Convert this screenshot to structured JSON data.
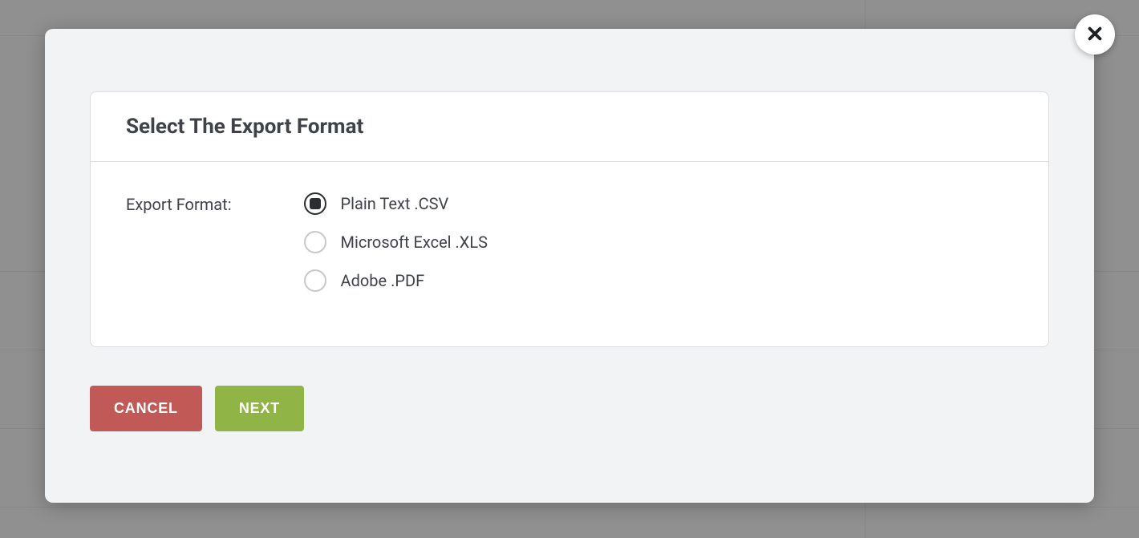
{
  "dialog": {
    "title": "Select The Export Format",
    "fieldLabel": "Export Format:",
    "options": [
      {
        "label": "Plain Text .CSV",
        "selected": true
      },
      {
        "label": "Microsoft Excel .XLS",
        "selected": false
      },
      {
        "label": "Adobe .PDF",
        "selected": false
      }
    ],
    "buttons": {
      "cancel": "CANCEL",
      "next": "NEXT"
    }
  }
}
